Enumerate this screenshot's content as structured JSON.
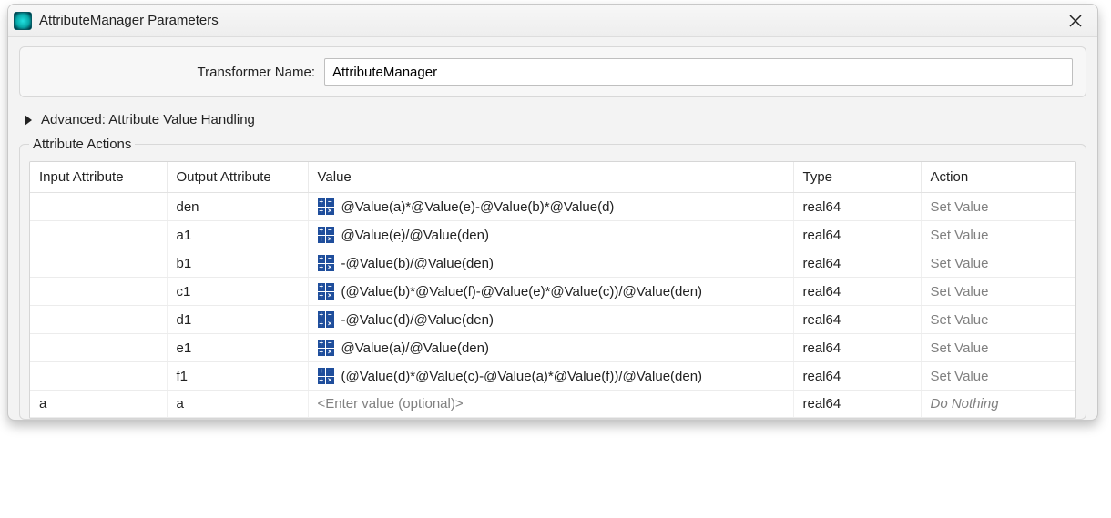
{
  "window": {
    "title": "AttributeManager Parameters"
  },
  "transformer": {
    "label": "Transformer Name:",
    "value": "AttributeManager"
  },
  "advanced": {
    "label": "Advanced: Attribute Value Handling"
  },
  "section": {
    "legend": "Attribute Actions"
  },
  "columns": {
    "input": "Input Attribute",
    "output": "Output Attribute",
    "value": "Value",
    "type": "Type",
    "action": "Action"
  },
  "rows": [
    {
      "input": "",
      "output": "den",
      "hasIcon": true,
      "value": "@Value(a)*@Value(e)-@Value(b)*@Value(d)",
      "type": "real64",
      "action": "Set Value",
      "actionClass": "action-cell"
    },
    {
      "input": "",
      "output": "a1",
      "hasIcon": true,
      "value": "@Value(e)/@Value(den)",
      "type": "real64",
      "action": "Set Value",
      "actionClass": "action-cell"
    },
    {
      "input": "",
      "output": "b1",
      "hasIcon": true,
      "value": "-@Value(b)/@Value(den)",
      "type": "real64",
      "action": "Set Value",
      "actionClass": "action-cell"
    },
    {
      "input": "",
      "output": "c1",
      "hasIcon": true,
      "value": "(@Value(b)*@Value(f)-@Value(e)*@Value(c))/@Value(den)",
      "type": "real64",
      "action": "Set Value",
      "actionClass": "action-cell"
    },
    {
      "input": "",
      "output": "d1",
      "hasIcon": true,
      "value": "-@Value(d)/@Value(den)",
      "type": "real64",
      "action": "Set Value",
      "actionClass": "action-cell"
    },
    {
      "input": "",
      "output": "e1",
      "hasIcon": true,
      "value": "@Value(a)/@Value(den)",
      "type": "real64",
      "action": "Set Value",
      "actionClass": "action-cell"
    },
    {
      "input": "",
      "output": "f1",
      "hasIcon": true,
      "value": "(@Value(d)*@Value(c)-@Value(a)*@Value(f))/@Value(den)",
      "type": "real64",
      "action": "Set Value",
      "actionClass": "action-cell"
    },
    {
      "input": "a",
      "output": "a",
      "hasIcon": false,
      "value": "<Enter value (optional)>",
      "type": "real64",
      "action": "Do Nothing",
      "actionClass": "donothing",
      "valueClass": "placeholder-cell"
    }
  ]
}
